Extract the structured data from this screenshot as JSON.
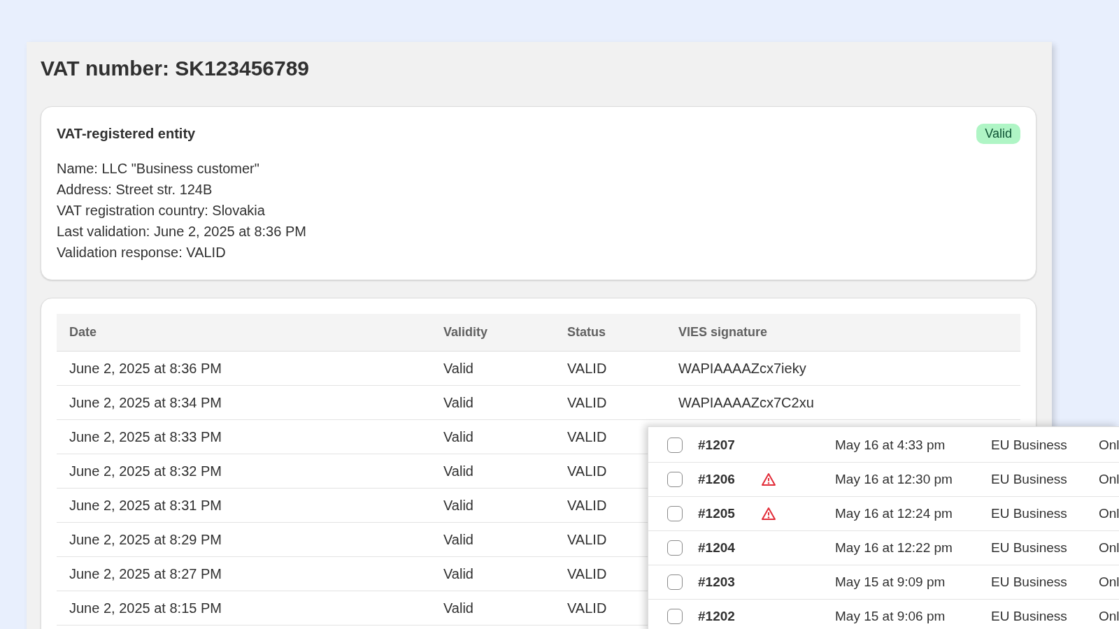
{
  "title": "VAT number: SK123456789",
  "entity": {
    "heading": "VAT-registered entity",
    "badge": "Valid",
    "lines": [
      "Name: LLC \"Business customer\"",
      "Address: Street str. 124B",
      "VAT registration country: Slovakia",
      "Last validation: June 2, 2025 at 8:36 PM",
      "Validation response: VALID"
    ]
  },
  "history": {
    "columns": [
      "Date",
      "Validity",
      "Status",
      "VIES signature"
    ],
    "rows": [
      {
        "date": "June 2, 2025 at 8:36 PM",
        "validity": "Valid",
        "status": "VALID",
        "signature": "WAPIAAAAZcx7ieky"
      },
      {
        "date": "June 2, 2025 at 8:34 PM",
        "validity": "Valid",
        "status": "VALID",
        "signature": "WAPIAAAAZcx7C2xu"
      },
      {
        "date": "June 2, 2025 at 8:33 PM",
        "validity": "Valid",
        "status": "VALID"
      },
      {
        "date": "June 2, 2025 at 8:32 PM",
        "validity": "Valid",
        "status": "VALID"
      },
      {
        "date": "June 2, 2025 at 8:31 PM",
        "validity": "Valid",
        "status": "VALID"
      },
      {
        "date": "June 2, 2025 at 8:29 PM",
        "validity": "Valid",
        "status": "VALID"
      },
      {
        "date": "June 2, 2025 at 8:27 PM",
        "validity": "Valid",
        "status": "VALID"
      },
      {
        "date": "June 2, 2025 at 8:15 PM",
        "validity": "Valid",
        "status": "VALID"
      }
    ]
  },
  "orders": [
    {
      "checked": false,
      "order": "#1207",
      "warning": false,
      "date": "May 16 at 4:33 pm",
      "customer_type": "EU Business",
      "column_5": "Onl"
    },
    {
      "checked": false,
      "order": "#1206",
      "warning": true,
      "date": "May 16 at 12:30 pm",
      "customer_type": "EU Business",
      "column_5": "Onl"
    },
    {
      "checked": false,
      "order": "#1205",
      "warning": true,
      "date": "May 16 at 12:24 pm",
      "customer_type": "EU Business",
      "column_5": "Onl"
    },
    {
      "checked": false,
      "order": "#1204",
      "warning": false,
      "date": "May 16 at 12:22 pm",
      "customer_type": "EU Business",
      "column_5": "Onl"
    },
    {
      "checked": false,
      "order": "#1203",
      "warning": false,
      "date": "May 15 at 9:09 pm",
      "customer_type": "EU Business",
      "column_5": "Onl"
    },
    {
      "checked": false,
      "order": "#1202",
      "warning": false,
      "date": "May 15 at 9:06 pm",
      "customer_type": "EU Business",
      "column_5": "Onl"
    }
  ]
}
